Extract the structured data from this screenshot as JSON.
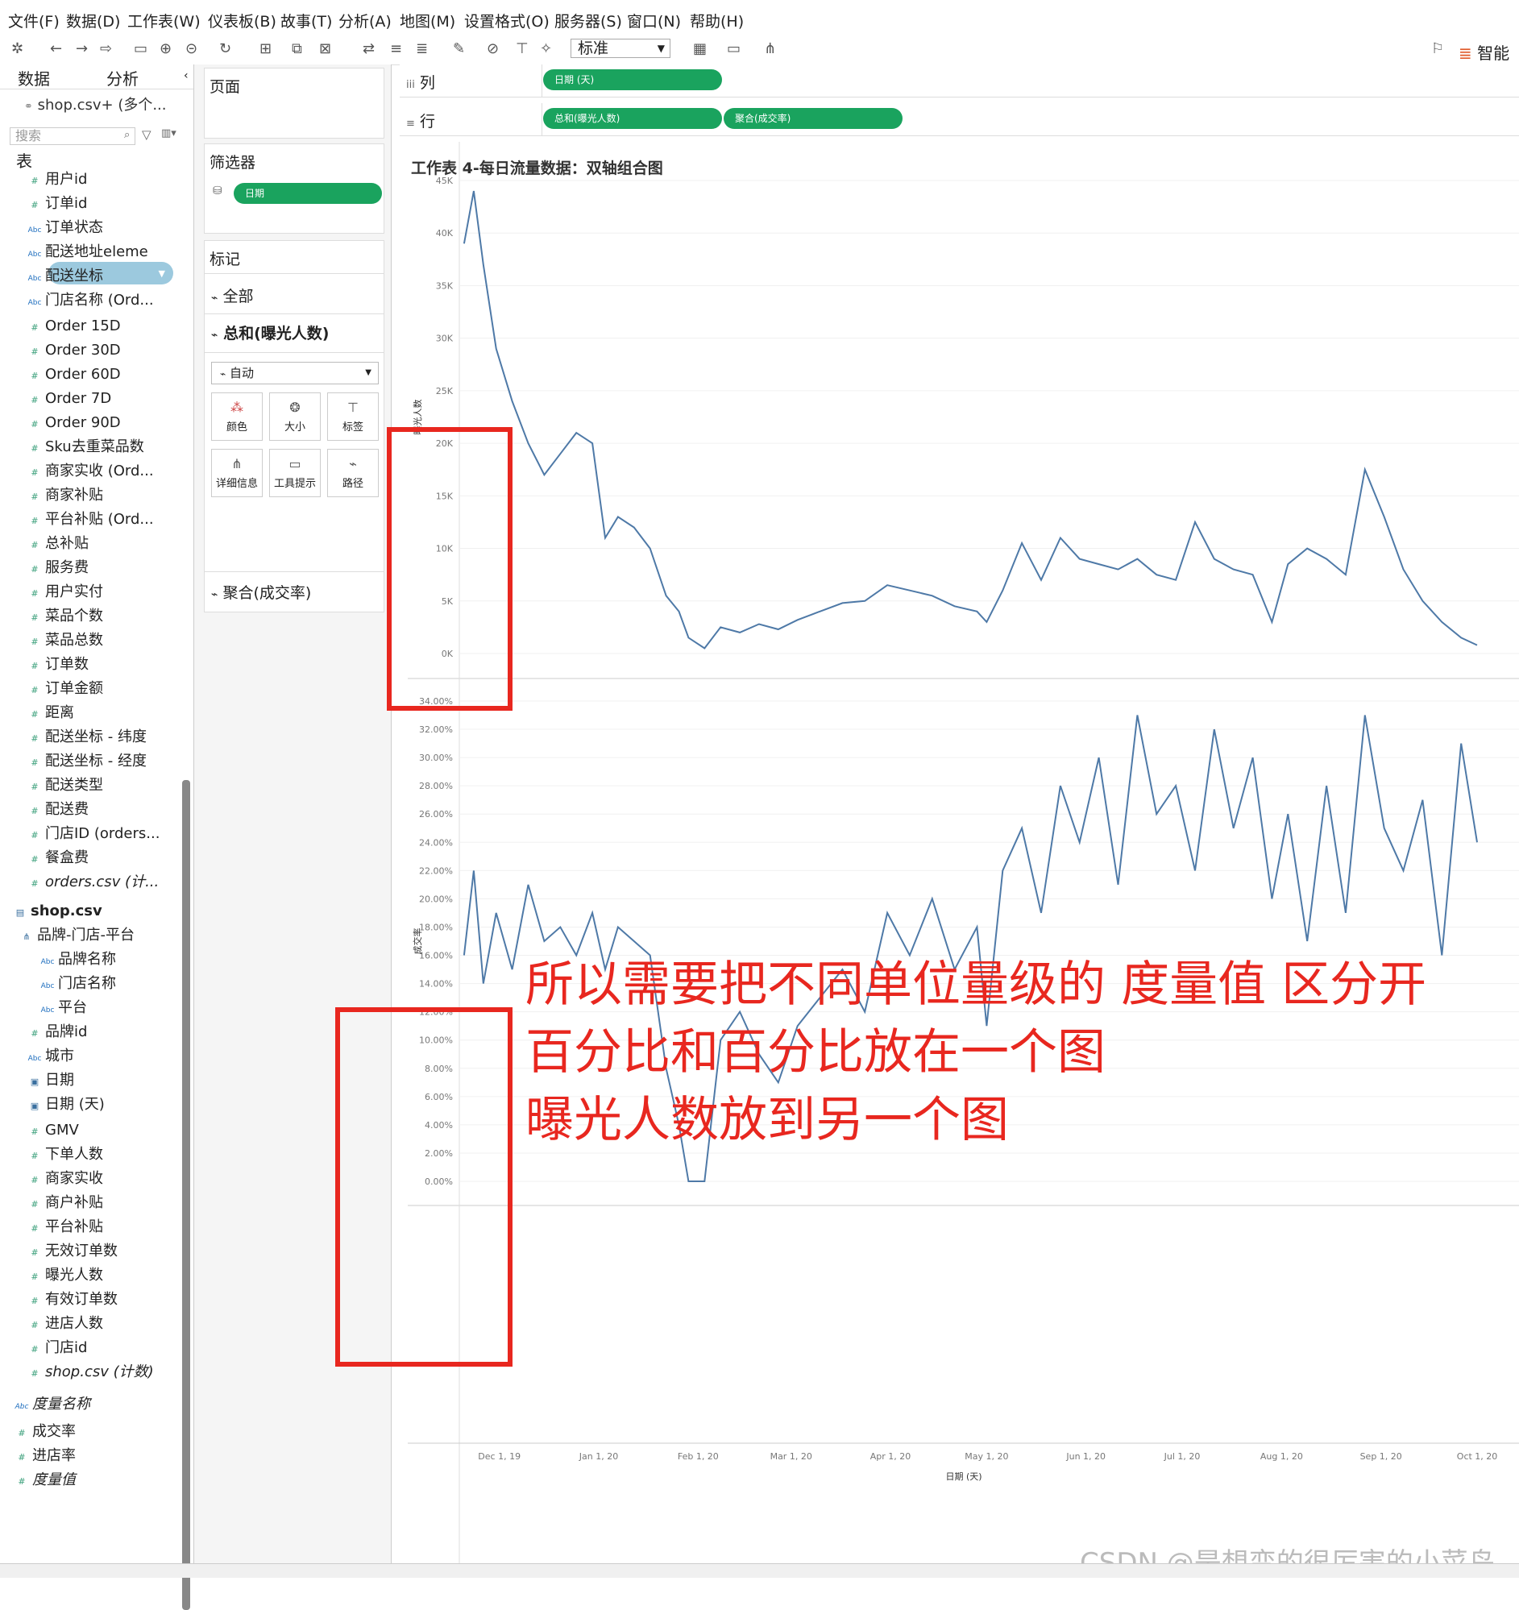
{
  "menu": [
    "文件(F)",
    "数据(D)",
    "工作表(W)",
    "仪表板(B)",
    "故事(T)",
    "分析(A)",
    "地图(M)",
    "设置格式(O)",
    "服务器(S)",
    "窗口(N)",
    "帮助(H)"
  ],
  "toolbar": {
    "fit_select": "标准",
    "smart": "智能显"
  },
  "left": {
    "tab_data": "数据",
    "tab_analysis": "分析",
    "source": "shop.csv+ (多个...",
    "search_placeholder": "搜索",
    "table_header": "表",
    "orders_fields": [
      {
        "icon": "#",
        "name": "用户id"
      },
      {
        "icon": "#",
        "name": "订单id"
      },
      {
        "icon": "Abc",
        "name": "订单状态"
      },
      {
        "icon": "Abc",
        "name": "配送地址eleme"
      },
      {
        "icon": "Abc",
        "name": "配送坐标"
      },
      {
        "icon": "Abc",
        "name": "门店名称 (Ord..."
      },
      {
        "icon": "#",
        "name": "Order 15D"
      },
      {
        "icon": "#",
        "name": "Order 30D"
      },
      {
        "icon": "#",
        "name": "Order 60D"
      },
      {
        "icon": "#",
        "name": "Order 7D"
      },
      {
        "icon": "#",
        "name": "Order 90D"
      },
      {
        "icon": "#",
        "name": "Sku去重菜品数"
      },
      {
        "icon": "#",
        "name": "商家实收 (Ord..."
      },
      {
        "icon": "#",
        "name": "商家补贴"
      },
      {
        "icon": "#",
        "name": "平台补贴 (Ord..."
      },
      {
        "icon": "#",
        "name": "总补贴"
      },
      {
        "icon": "#",
        "name": "服务费"
      },
      {
        "icon": "#",
        "name": "用户实付"
      },
      {
        "icon": "#",
        "name": "菜品个数"
      },
      {
        "icon": "#",
        "name": "菜品总数"
      },
      {
        "icon": "#",
        "name": "订单数"
      },
      {
        "icon": "#",
        "name": "订单金额"
      },
      {
        "icon": "#",
        "name": "距离"
      },
      {
        "icon": "#",
        "name": "配送坐标 - 纬度"
      },
      {
        "icon": "#",
        "name": "配送坐标 - 经度"
      },
      {
        "icon": "#",
        "name": "配送类型"
      },
      {
        "icon": "#",
        "name": "配送费"
      },
      {
        "icon": "#",
        "name": "门店ID (orders..."
      },
      {
        "icon": "#",
        "name": "餐盒费"
      },
      {
        "icon": "#",
        "name": "orders.csv (计..."
      }
    ],
    "shop_table": "shop.csv",
    "hierarchy": "品牌-门店-平台",
    "hierarchy_children": [
      "品牌名称",
      "门店名称",
      "平台"
    ],
    "shop_fields": [
      {
        "icon": "#",
        "name": "品牌id"
      },
      {
        "icon": "Abc",
        "name": "城市"
      },
      {
        "icon": "date",
        "name": "日期"
      },
      {
        "icon": "date",
        "name": "日期 (天)"
      },
      {
        "icon": "#",
        "name": "GMV"
      },
      {
        "icon": "#",
        "name": "下单人数"
      },
      {
        "icon": "#",
        "name": "商家实收"
      },
      {
        "icon": "#",
        "name": "商户补贴"
      },
      {
        "icon": "#",
        "name": "平台补贴"
      },
      {
        "icon": "#",
        "name": "无效订单数"
      },
      {
        "icon": "#",
        "name": "曝光人数"
      },
      {
        "icon": "#",
        "name": "有效订单数"
      },
      {
        "icon": "#",
        "name": "进店人数"
      },
      {
        "icon": "#",
        "name": "门店id"
      },
      {
        "icon": "#",
        "name": "shop.csv (计数)"
      }
    ],
    "measure_names": "度量名称",
    "calc_fields": [
      "成交率",
      "进店率",
      "度量值"
    ]
  },
  "mid": {
    "pages": "页面",
    "filters": "筛选器",
    "filter_pill": "日期",
    "marks": "标记",
    "marks_all": "全部",
    "marks_sum": "总和(曝光人数)",
    "marks_type": "自动",
    "mark_buttons": [
      "颜色",
      "大小",
      "标签",
      "详细信息",
      "工具提示",
      "路径"
    ],
    "marks_agg": "聚合(成交率)"
  },
  "shelves": {
    "columns_label": "列",
    "columns_pill": "日期 (天)",
    "rows_label": "行",
    "rows_pill1": "总和(曝光人数)",
    "rows_pill2": "聚合(成交率)"
  },
  "viz": {
    "title": "工作表 4-每日流量数据：双轴组合图"
  },
  "annotation": [
    "所以需要把不同单位量级的 度量值 区分开",
    "百分比和百分比放在一个图",
    "曝光人数放到另一个图"
  ],
  "watermark": "CSDN @是想变的很厉害的小菜鸟",
  "chart_data": [
    {
      "type": "line",
      "ylabel": "曝光人数",
      "y_ticks": [
        "0K",
        "5K",
        "10K",
        "15K",
        "20K",
        "25K",
        "30K",
        "35K",
        "40K",
        "45K"
      ],
      "ylim": [
        0,
        45000
      ],
      "x_ticks": [
        "Dec 1, 19",
        "Jan 1, 20",
        "Feb 1, 20",
        "Mar 1, 20",
        "Apr 1, 20",
        "May 1, 20",
        "Jun 1, 20",
        "Jul 1, 20",
        "Aug 1, 20",
        "Sep 1, 20",
        "Oct 1, 20"
      ],
      "xlabel": "日期 (天)",
      "x": [
        "2019-11-20",
        "2019-11-23",
        "2019-11-26",
        "2019-11-30",
        "2019-12-05",
        "2019-12-10",
        "2019-12-15",
        "2019-12-20",
        "2019-12-25",
        "2019-12-30",
        "2020-01-03",
        "2020-01-07",
        "2020-01-12",
        "2020-01-17",
        "2020-01-22",
        "2020-01-26",
        "2020-01-29",
        "2020-02-03",
        "2020-02-08",
        "2020-02-14",
        "2020-02-20",
        "2020-02-26",
        "2020-03-03",
        "2020-03-10",
        "2020-03-17",
        "2020-03-24",
        "2020-03-31",
        "2020-04-07",
        "2020-04-14",
        "2020-04-21",
        "2020-04-28",
        "2020-05-01",
        "2020-05-06",
        "2020-05-12",
        "2020-05-18",
        "2020-05-24",
        "2020-05-30",
        "2020-06-05",
        "2020-06-11",
        "2020-06-17",
        "2020-06-23",
        "2020-06-29",
        "2020-07-05",
        "2020-07-11",
        "2020-07-17",
        "2020-07-23",
        "2020-07-29",
        "2020-08-03",
        "2020-08-09",
        "2020-08-15",
        "2020-08-21",
        "2020-08-27",
        "2020-09-02",
        "2020-09-08",
        "2020-09-14",
        "2020-09-20",
        "2020-09-26",
        "2020-10-01"
      ],
      "values": [
        39000,
        44000,
        37000,
        29000,
        24000,
        20000,
        17000,
        19000,
        21000,
        20000,
        11000,
        13000,
        12000,
        10000,
        5500,
        4000,
        1500,
        500,
        2500,
        2000,
        2800,
        2300,
        3200,
        4000,
        4800,
        5000,
        6500,
        6000,
        5500,
        4500,
        4000,
        3000,
        6000,
        10500,
        7000,
        11000,
        9000,
        8500,
        8000,
        9000,
        7500,
        7000,
        12500,
        9000,
        8000,
        7500,
        3000,
        8500,
        10000,
        9000,
        7500,
        17500,
        13000,
        8000,
        5000,
        3000,
        1500,
        800
      ]
    },
    {
      "type": "line",
      "ylabel": "成交率",
      "y_ticks": [
        "0.00%",
        "2.00%",
        "4.00%",
        "6.00%",
        "8.00%",
        "10.00%",
        "12.00%",
        "14.00%",
        "16.00%",
        "18.00%",
        "20.00%",
        "22.00%",
        "24.00%",
        "26.00%",
        "28.00%",
        "30.00%",
        "32.00%",
        "34.00%"
      ],
      "ylim": [
        0,
        34
      ],
      "x": [
        "2019-11-20",
        "2019-11-23",
        "2019-11-26",
        "2019-11-30",
        "2019-12-05",
        "2019-12-10",
        "2019-12-15",
        "2019-12-20",
        "2019-12-25",
        "2019-12-30",
        "2020-01-03",
        "2020-01-07",
        "2020-01-12",
        "2020-01-17",
        "2020-01-22",
        "2020-01-26",
        "2020-01-29",
        "2020-02-03",
        "2020-02-08",
        "2020-02-14",
        "2020-02-20",
        "2020-02-26",
        "2020-03-03",
        "2020-03-10",
        "2020-03-17",
        "2020-03-24",
        "2020-03-31",
        "2020-04-07",
        "2020-04-14",
        "2020-04-21",
        "2020-04-28",
        "2020-05-01",
        "2020-05-06",
        "2020-05-12",
        "2020-05-18",
        "2020-05-24",
        "2020-05-30",
        "2020-06-05",
        "2020-06-11",
        "2020-06-17",
        "2020-06-23",
        "2020-06-29",
        "2020-07-05",
        "2020-07-11",
        "2020-07-17",
        "2020-07-23",
        "2020-07-29",
        "2020-08-03",
        "2020-08-09",
        "2020-08-15",
        "2020-08-21",
        "2020-08-27",
        "2020-09-02",
        "2020-09-08",
        "2020-09-14",
        "2020-09-20",
        "2020-09-26",
        "2020-10-01"
      ],
      "values": [
        16,
        22,
        14,
        19,
        15,
        21,
        17,
        18,
        16,
        19,
        15,
        18,
        17,
        16,
        8,
        4,
        0,
        0,
        10,
        12,
        9,
        7,
        11,
        13,
        15,
        12,
        19,
        16,
        20,
        15,
        18,
        11,
        22,
        25,
        19,
        28,
        24,
        30,
        21,
        33,
        26,
        28,
        22,
        32,
        25,
        30,
        20,
        26,
        17,
        28,
        19,
        33,
        25,
        22,
        27,
        16,
        31,
        24
      ]
    }
  ]
}
